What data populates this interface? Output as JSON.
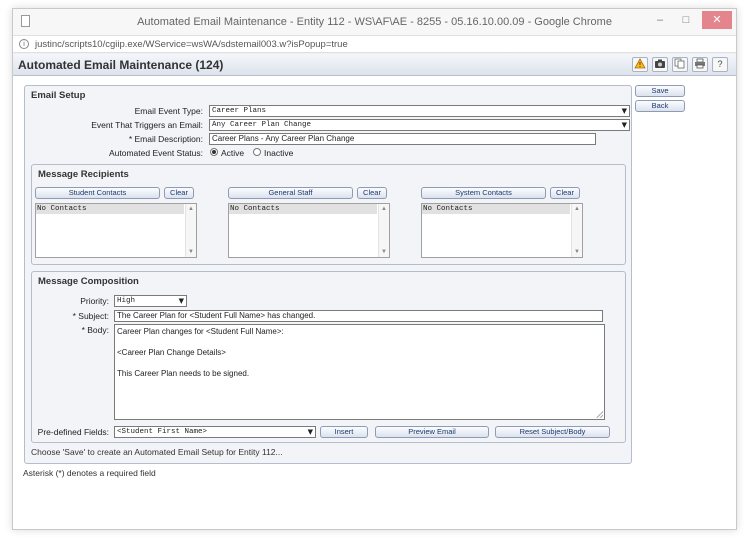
{
  "window": {
    "title": "Automated Email Maintenance - Entity 112 - WS\\AF\\AE - 8255 - 05.16.10.00.09 - Google Chrome",
    "url": "justinc/scripts10/cgiip.exe/WService=wsWA/sdstemail003.w?isPopup=true",
    "min_glyph": "–",
    "max_glyph": "□",
    "close_glyph": "✕"
  },
  "header": {
    "title": "Automated Email Maintenance (124)",
    "icons": [
      "warning-icon",
      "camera-icon",
      "copy-icon",
      "print-icon",
      "help-icon"
    ],
    "help_glyph": "?"
  },
  "side_buttons": {
    "save": "Save",
    "back": "Back"
  },
  "email_setup": {
    "title": "Email Setup",
    "event_type_label": "Email Event Type:",
    "event_type_value": "Career Plans",
    "trigger_label": "Event That Triggers an Email:",
    "trigger_value": "Any Career Plan Change",
    "description_label": "* Email Description:",
    "description_value": "Career Plans - Any Career Plan Change",
    "status_label": "Automated Event Status:",
    "status_active": "Active",
    "status_inactive": "Inactive"
  },
  "recipients": {
    "title": "Message Recipients",
    "clear_label": "Clear",
    "lists": [
      {
        "button": "Student Contacts",
        "item": "No Contacts"
      },
      {
        "button": "General Staff",
        "item": "No Contacts"
      },
      {
        "button": "System Contacts",
        "item": "No Contacts"
      }
    ]
  },
  "composition": {
    "title": "Message Composition",
    "priority_label": "Priority:",
    "priority_value": "High",
    "subject_label": "* Subject:",
    "subject_value": "The Career Plan for <Student Full Name> has changed.",
    "body_label": "* Body:",
    "body_lines": [
      "Career Plan changes for <Student Full Name>:",
      "<Career Plan Change Details>",
      "This Career Plan needs to be signed."
    ],
    "fields_label": "Pre-defined Fields:",
    "fields_value": "<Student First Name>",
    "insert_label": "Insert",
    "preview_label": "Preview Email",
    "reset_label": "Reset Subject/Body"
  },
  "status_message": "Choose 'Save' to create an Automated Email Setup for Entity 112...",
  "footnote": "Asterisk (*) denotes a required field"
}
